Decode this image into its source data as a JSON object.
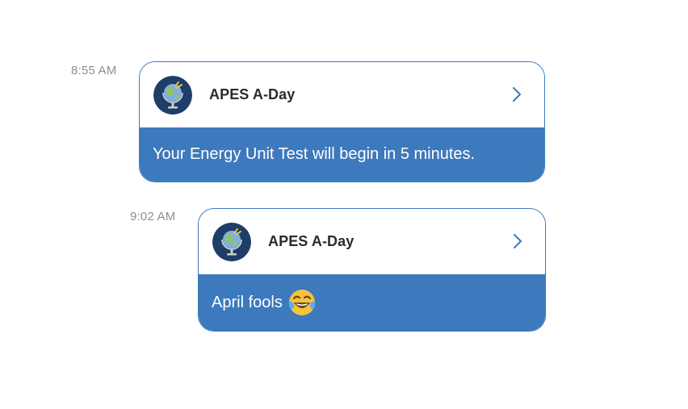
{
  "notifications": [
    {
      "time": "8:55 AM",
      "app_name": "APES A-Day",
      "app_icon": "globe-icon",
      "message": "Your Energy Unit Test will begin in 5 minutes."
    },
    {
      "time": "9:02 AM",
      "app_name": "APES A-Day",
      "app_icon": "globe-icon",
      "message": "April fools",
      "emoji": "tears-of-joy-emoji"
    }
  ],
  "colors": {
    "accent": "#3d79bd",
    "timestamp": "#8e8e93",
    "icon_bg": "#1f3d66"
  }
}
